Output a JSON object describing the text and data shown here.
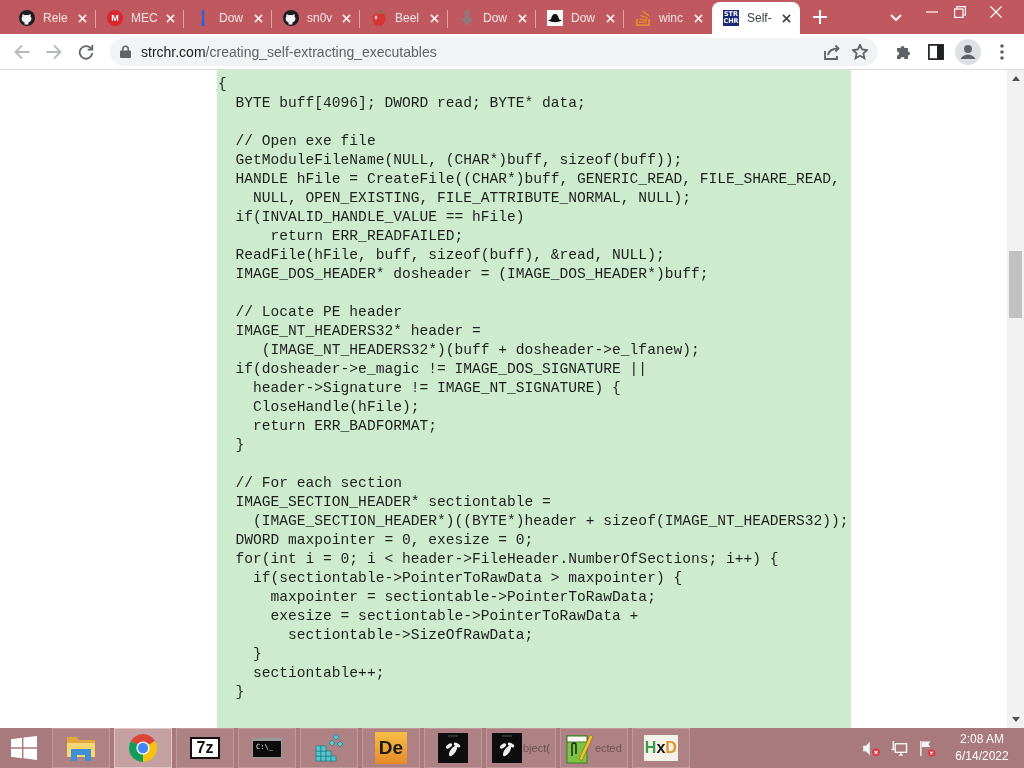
{
  "browser": {
    "tabs": [
      {
        "title": "Rele",
        "kind": "cat",
        "selected": false
      },
      {
        "title": "MEC",
        "kind": "letter",
        "glyph": "M",
        "selected": false
      },
      {
        "title": "Dow",
        "kind": "figure",
        "selected": false
      },
      {
        "title": "sn0v",
        "kind": "cat",
        "selected": false
      },
      {
        "title": "Beel",
        "kind": "apple",
        "selected": false
      },
      {
        "title": "Dow",
        "kind": "arrow",
        "selected": false
      },
      {
        "title": "Dow",
        "kind": "hat",
        "selected": false
      },
      {
        "title": "winc",
        "kind": "tray",
        "selected": false
      },
      {
        "title": "Self-",
        "kind": "badge",
        "badge_lines": [
          "STR",
          "CHR"
        ],
        "selected": true
      }
    ],
    "toolbar": {
      "back": {
        "disabled": true
      },
      "forward": {
        "disabled": true
      },
      "url_host": "strchr.com",
      "url_path": "/creating_self-extracting_executables"
    }
  },
  "page": {
    "code_blocks": [
      [
        "{",
        "  BYTE buff[4096]; DWORD read; BYTE* data;"
      ],
      [
        "  // Open exe file",
        "  GetModuleFileName(NULL, (CHAR*)buff, sizeof(buff));",
        "  HANDLE hFile = CreateFile((CHAR*)buff, GENERIC_READ, FILE_SHARE_READ,",
        "    NULL, OPEN_EXISTING, FILE_ATTRIBUTE_NORMAL, NULL);",
        "  if(INVALID_HANDLE_VALUE == hFile)",
        "      return ERR_READFAILED;",
        "  ReadFile(hFile, buff, sizeof(buff), &read, NULL);",
        "  IMAGE_DOS_HEADER* dosheader = (IMAGE_DOS_HEADER*)buff;"
      ],
      [
        "  // Locate PE header",
        "  IMAGE_NT_HEADERS32* header =",
        "     (IMAGE_NT_HEADERS32*)(buff + dosheader->e_lfanew);",
        "  if(dosheader->e_magic != IMAGE_DOS_SIGNATURE ||",
        "    header->Signature != IMAGE_NT_SIGNATURE) {",
        "    CloseHandle(hFile);",
        "    return ERR_BADFORMAT;",
        "  }"
      ],
      [
        "  // For each section",
        "  IMAGE_SECTION_HEADER* sectiontable =",
        "    (IMAGE_SECTION_HEADER*)((BYTE*)header + sizeof(IMAGE_NT_HEADERS32));",
        "  DWORD maxpointer = 0, exesize = 0;",
        "  for(int i = 0; i < header->FileHeader.NumberOfSections; i++) {",
        "    if(sectiontable->PointerToRawData > maxpointer) {",
        "      maxpointer = sectiontable->PointerToRawData;",
        "      exesize = sectiontable->PointerToRawData +",
        "        sectiontable->SizeOfRawData;",
        "    }",
        "    sectiontable++;",
        "  }"
      ]
    ]
  },
  "taskbar": {
    "items": [
      {
        "kind": "start",
        "selected": false
      },
      {
        "kind": "folder",
        "selected": false
      },
      {
        "kind": "browser",
        "selected": true
      },
      {
        "kind": "tile",
        "glyph": "7z",
        "selected": false
      },
      {
        "kind": "console",
        "glyph": "C:\\_",
        "selected": false
      },
      {
        "kind": "cubes",
        "selected": false
      },
      {
        "kind": "letters",
        "glyph": "De",
        "selected": false
      },
      {
        "kind": "insect",
        "selected": false
      },
      {
        "kind": "insect",
        "label": "bject(",
        "selected": false
      },
      {
        "kind": "notepad",
        "label": "ected",
        "selected": false
      },
      {
        "kind": "hex",
        "glyph": "HxD",
        "selected": false
      }
    ],
    "clock": {
      "time": "2:08 AM",
      "date": "6/14/2022"
    }
  }
}
